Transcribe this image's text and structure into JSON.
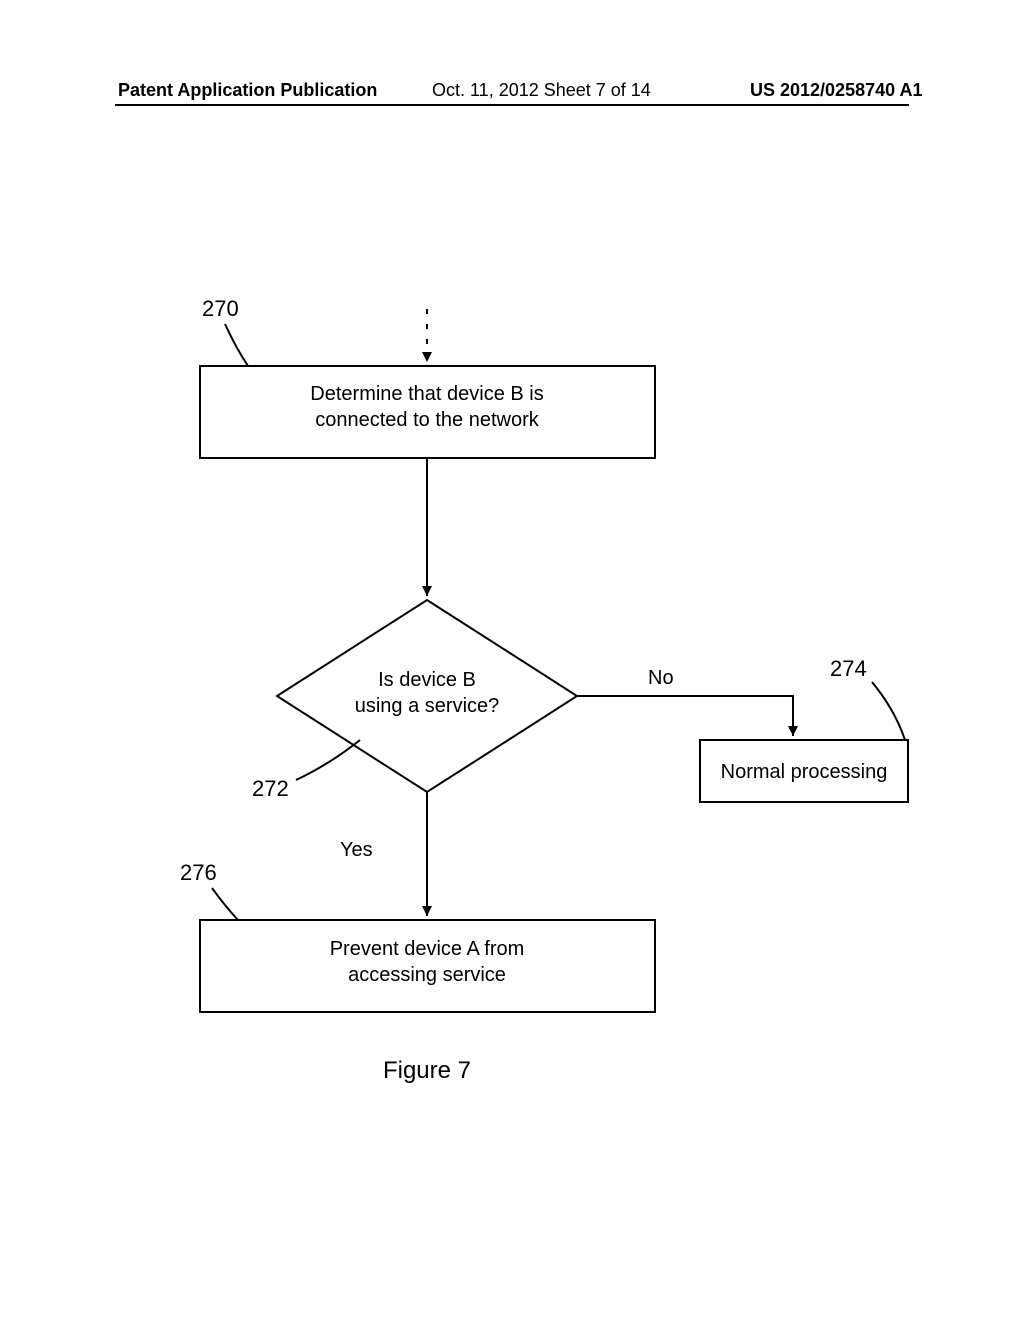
{
  "header": {
    "left": "Patent Application Publication",
    "mid": "Oct. 11, 2012  Sheet 7 of 14",
    "right": "US 2012/0258740 A1"
  },
  "refs": {
    "r270": "270",
    "r272": "272",
    "r274": "274",
    "r276": "276"
  },
  "boxes": {
    "b270_l1": "Determine that device B is",
    "b270_l2": "connected to the network",
    "b274": "Normal processing",
    "b276_l1": "Prevent device A from",
    "b276_l2": "accessing service"
  },
  "decision": {
    "l1": "Is device B",
    "l2": "using a service?"
  },
  "labels": {
    "no": "No",
    "yes": "Yes"
  },
  "caption": "Figure 7"
}
